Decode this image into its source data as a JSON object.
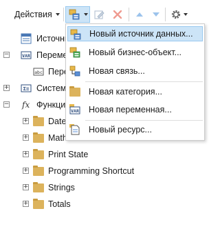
{
  "toolbar": {
    "actions_label": "Действия",
    "buttons": [
      "new-source",
      "edit",
      "delete",
      "move-up",
      "move-down",
      "settings"
    ]
  },
  "tree": {
    "items": [
      {
        "label": "Источник",
        "icon": "datasource-icon",
        "toggle": ""
      },
      {
        "label": "Переменные",
        "icon": "variable-icon",
        "toggle": "−"
      },
      {
        "label": "Переменная",
        "icon": "abc-icon",
        "toggle": ""
      },
      {
        "label": "Системные",
        "icon": "system-var-icon",
        "toggle": "+"
      },
      {
        "label": "Функции",
        "icon": "fx-icon",
        "toggle": "−"
      },
      {
        "label": "Date",
        "icon": "folder-icon",
        "toggle": "+"
      },
      {
        "label": "Math",
        "icon": "folder-icon",
        "toggle": "+"
      },
      {
        "label": "Print State",
        "icon": "folder-icon",
        "toggle": "+"
      },
      {
        "label": "Programming Shortcut",
        "icon": "folder-icon",
        "toggle": "+"
      },
      {
        "label": "Strings",
        "icon": "folder-icon",
        "toggle": "+"
      },
      {
        "label": "Totals",
        "icon": "folder-icon",
        "toggle": "+"
      }
    ]
  },
  "menu": {
    "items": [
      {
        "label": "Новый источник данных...",
        "icon": "new-datasource-icon",
        "highlighted": true
      },
      {
        "label": "Новый бизнес-объект...",
        "icon": "business-object-icon",
        "highlighted": false
      },
      {
        "label": "Новая связь...",
        "icon": "relation-icon",
        "highlighted": false
      },
      {
        "label": "Новая категория...",
        "icon": "folder-icon",
        "highlighted": false
      },
      {
        "label": "Новая переменная...",
        "icon": "variable-icon",
        "highlighted": false
      },
      {
        "label": "Новый ресурс...",
        "icon": "resource-icon",
        "highlighted": false
      }
    ]
  },
  "colors": {
    "highlight_bg": "#cce4f7",
    "highlight_border": "#99c9ef",
    "folder": "#dcb35c",
    "delete_red": "#e04a3a",
    "arrow_blue": "#4a90d9"
  }
}
